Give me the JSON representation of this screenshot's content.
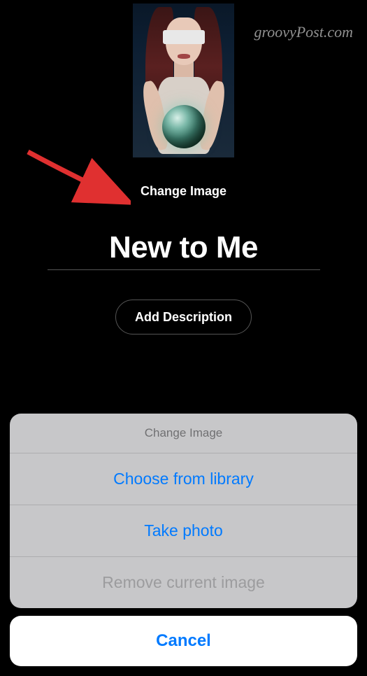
{
  "watermark": "groovyPost.com",
  "change_image_link": "Change Image",
  "playlist_title": "New to Me",
  "add_description_label": "Add Description",
  "action_sheet": {
    "title": "Change Image",
    "options": [
      {
        "label": "Choose from library",
        "enabled": true
      },
      {
        "label": "Take photo",
        "enabled": true
      },
      {
        "label": "Remove current image",
        "enabled": false
      }
    ],
    "cancel": "Cancel"
  }
}
